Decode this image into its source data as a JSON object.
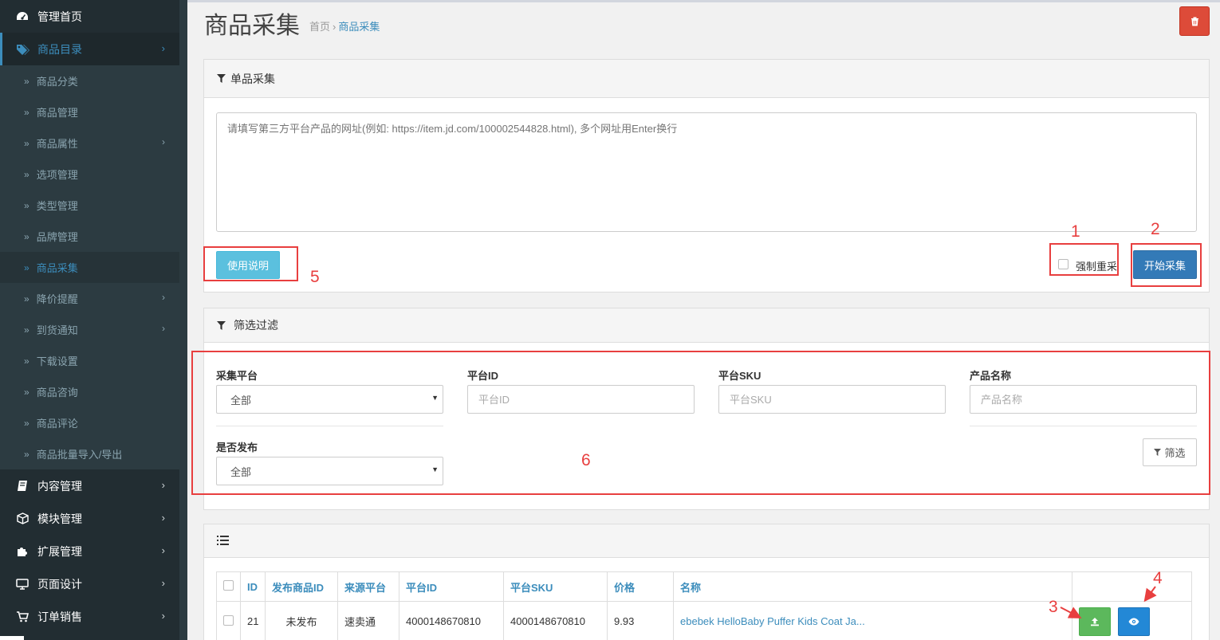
{
  "sidebar": {
    "top_items": [
      {
        "label": "管理首页",
        "icon": "dashboard-icon"
      },
      {
        "label": "商品目录",
        "icon": "tags-icon"
      }
    ],
    "sub_items": [
      {
        "label": "商品分类"
      },
      {
        "label": "商品管理"
      },
      {
        "label": "商品属性"
      },
      {
        "label": "选项管理"
      },
      {
        "label": "类型管理"
      },
      {
        "label": "品牌管理"
      },
      {
        "label": "商品采集"
      },
      {
        "label": "降价提醒"
      },
      {
        "label": "到货通知"
      },
      {
        "label": "下载设置"
      },
      {
        "label": "商品咨询"
      },
      {
        "label": "商品评论"
      },
      {
        "label": "商品批量导入/导出"
      }
    ],
    "bottom_items": [
      {
        "label": "内容管理",
        "icon": "book-icon"
      },
      {
        "label": "模块管理",
        "icon": "cube-icon"
      },
      {
        "label": "扩展管理",
        "icon": "puzzle-icon"
      },
      {
        "label": "页面设计",
        "icon": "desktop-icon"
      },
      {
        "label": "订单销售",
        "icon": "cart-icon"
      }
    ]
  },
  "header": {
    "title": "商品采集",
    "breadcrumb": [
      "首页",
      "商品采集"
    ],
    "delete_icon": "trash-icon"
  },
  "single_collect": {
    "title": "单品采集",
    "textarea_placeholder": "请填写第三方平台产品的网址(例如: https://item.jd.com/100002544828.html), 多个网址用Enter换行",
    "help_button": "使用说明",
    "force_label": "强制重采",
    "start_button": "开始采集"
  },
  "filter": {
    "title": "筛选过滤",
    "platform_label": "采集平台",
    "platform_value": "全部",
    "platform_id_label": "平台ID",
    "platform_id_placeholder": "平台ID",
    "platform_sku_label": "平台SKU",
    "platform_sku_placeholder": "平台SKU",
    "product_name_label": "产品名称",
    "product_name_placeholder": "产品名称",
    "published_label": "是否发布",
    "published_value": "全部",
    "filter_button": "筛选"
  },
  "table": {
    "columns": [
      "ID",
      "发布商品ID",
      "来源平台",
      "平台ID",
      "平台SKU",
      "价格",
      "名称"
    ],
    "rows": [
      {
        "id": "21",
        "published_id": "未发布",
        "source": "速卖通",
        "platform_id": "4000148670810",
        "platform_sku": "4000148670810",
        "price": "9.93",
        "name": "ebebek HelloBaby Puffer Kids Coat Ja..."
      }
    ]
  },
  "annotations": [
    "1",
    "2",
    "3",
    "4",
    "5",
    "6"
  ],
  "colors": {
    "sidebar_bg": "#222d32",
    "accent": "#3c8dbc",
    "danger": "#dd4b39",
    "annotation_red": "#e83f3f"
  }
}
